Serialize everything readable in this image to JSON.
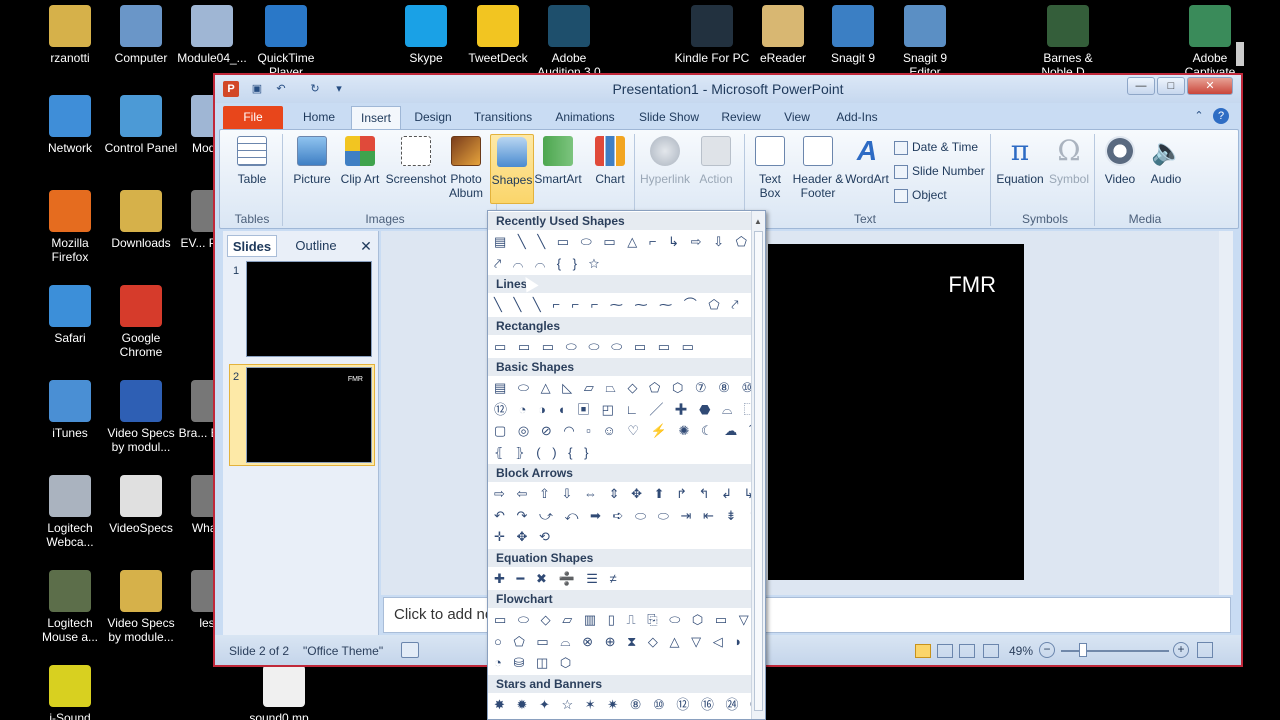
{
  "desktop": {
    "icons": [
      {
        "label": "rzanotti",
        "color": "#d6b14a"
      },
      {
        "label": "Computer",
        "color": "#6a96c8"
      },
      {
        "label": "Module04_...",
        "color": "#9fb6d4"
      },
      {
        "label": "QuickTime Player",
        "color": "#2a78c8"
      },
      {
        "label": "Skype",
        "color": "#1aa1e6"
      },
      {
        "label": "TweetDeck",
        "color": "#f2c521"
      },
      {
        "label": "Adobe Audition 3.0",
        "color": "#1e4f6c"
      },
      {
        "label": "Kindle For PC",
        "color": "#22313f"
      },
      {
        "label": "eReader",
        "color": "#d8b772"
      },
      {
        "label": "Snagit 9",
        "color": "#3b7fc4"
      },
      {
        "label": "Snagit 9 Editor",
        "color": "#5b8fc4"
      },
      {
        "label": "Barnes & Noble D...",
        "color": "#345e3a"
      },
      {
        "label": "Adobe Captivate",
        "color": "#3a8b5a"
      },
      {
        "label": "Network",
        "color": "#3f8ed8"
      },
      {
        "label": "Control Panel",
        "color": "#4c9ad6"
      },
      {
        "label": "Modu...",
        "color": "#9fb6d4"
      },
      {
        "label": "Mozilla Firefox",
        "color": "#e56c1f"
      },
      {
        "label": "Downloads",
        "color": "#d6b14a"
      },
      {
        "label": "EV... Prec...",
        "color": "#777"
      },
      {
        "label": "Safari",
        "color": "#3c8fd9"
      },
      {
        "label": "Google Chrome",
        "color": "#d63b2b"
      },
      {
        "label": "iTunes",
        "color": "#4a8fd4"
      },
      {
        "label": "Video Specs by modul...",
        "color": "#2e5fb4"
      },
      {
        "label": "Bra... Ener...",
        "color": "#777"
      },
      {
        "label": "Logitech Webca...",
        "color": "#aab3bf"
      },
      {
        "label": "VideoSpecs",
        "color": "#e0e0e0"
      },
      {
        "label": "What'...",
        "color": "#777"
      },
      {
        "label": "Logitech Mouse a...",
        "color": "#5c6e4a"
      },
      {
        "label": "Video Specs by module...",
        "color": "#d6b14a"
      },
      {
        "label": "les...",
        "color": "#777"
      },
      {
        "label": "i-Sound",
        "color": "#d8d020"
      },
      {
        "label": "sound0.mp...",
        "color": "#f0f0f0"
      }
    ]
  },
  "window": {
    "title": "Presentation1 - Microsoft PowerPoint",
    "app_icon": "P",
    "controls": {
      "minimize": "—",
      "maximize": "□",
      "close": "✕"
    },
    "accent": "#e8461b"
  },
  "tabs": [
    "File",
    "Home",
    "Insert",
    "Design",
    "Transitions",
    "Animations",
    "Slide Show",
    "Review",
    "View",
    "Add-Ins"
  ],
  "active_tab": "Insert",
  "ribbon": {
    "tables": {
      "table": "Table",
      "group": "Tables"
    },
    "images": {
      "picture": "Picture",
      "clipart": "Clip Art",
      "screenshot": "Screenshot",
      "photo_album": "Photo Album",
      "group": "Images"
    },
    "illustrations": {
      "shapes": "Shapes",
      "smartart": "SmartArt",
      "chart": "Chart"
    },
    "links": {
      "hyperlink": "Hyperlink",
      "action": "Action"
    },
    "text": {
      "textbox": "Text Box",
      "header_footer": "Header & Footer",
      "wordart": "WordArt",
      "date_time": "Date & Time",
      "slide_number": "Slide Number",
      "object": "Object",
      "group": "Text"
    },
    "symbols": {
      "equation": "Equation",
      "symbol": "Symbol",
      "group": "Symbols"
    },
    "media": {
      "video": "Video",
      "audio": "Audio",
      "group": "Media"
    }
  },
  "panel": {
    "tab_slides": "Slides",
    "tab_outline": "Outline",
    "close": "✕",
    "slides": [
      {
        "num": "1",
        "text": ""
      },
      {
        "num": "2",
        "text": "FMR"
      }
    ]
  },
  "slide": {
    "text": "FMR"
  },
  "notes_placeholder": "Click to add no",
  "status": {
    "slide": "Slide 2 of 2",
    "theme": "\"Office Theme\"",
    "zoom": "49%"
  },
  "shapes_menu": {
    "sections": [
      {
        "title": "Recently Used Shapes",
        "rows": [
          "▤ ╲ ╲ ▭ ⬭ ▭ △ ⌐ ↳ ⇨ ⇩ ⬠",
          "⤤ ⌒ ⌒ { } ☆"
        ]
      },
      {
        "title": "Lines",
        "rows": [
          "╲ ╲ ╲ ⌐ ⌐ ⌐ ⁓ ⁓ ⁓ ⌒ ⬠ ⤤"
        ]
      },
      {
        "title": "Rectangles",
        "rows": [
          "▭ ▭ ▭ ⬭ ⬭ ⬭ ▭ ▭ ▭"
        ]
      },
      {
        "title": "Basic Shapes",
        "rows": [
          "▤ ⬭ △ ◺ ▱ ⏢ ◇ ⬠ ⬡ ⑦ ⑧ ⑩",
          "⑫ ◔ ◑ ◖ ▣ ◰ ∟ ╱ ✚ ⬣ ⌓ ⬚",
          "▢ ◎ ⊘ ◠ ▫ ☺ ♡ ⚡ ✺ ☾ ☁ ⌒",
          "⦃ ⦄ ( ) { }"
        ]
      },
      {
        "title": "Block Arrows",
        "rows": [
          "⇨ ⇦ ⇧ ⇩ ⇔ ⇕ ✥ ⬆ ↱ ↰ ↲ ↳",
          "↶ ↷ ⤻ ⤺ ➡ ➪ ⬭ ⬭ ⇥ ⇤ ⇟ ⇞",
          "✛ ✥ ⟲"
        ]
      },
      {
        "title": "Equation Shapes",
        "rows": [
          "✚ ━ ✖ ➗ ☰ ≠"
        ]
      },
      {
        "title": "Flowchart",
        "rows": [
          "▭ ⬭ ◇ ▱ ▥ ▯ ⎍ ⎘ ⬭ ⬡ ▭ ▽",
          "○ ⬠ ▭ ⌓ ⊗ ⊕ ⧗ ◇ △ ▽ ◁ ◗",
          "◔ ⛁ ◫ ⬡"
        ]
      },
      {
        "title": "Stars and Banners",
        "rows": [
          "✸ ✹ ✦ ☆ ✶ ✷ ⑧ ⑩ ⑫ ⑯ ㉔ ㉜",
          "⌇ ⌇ ⌇ ⌇ ⌇ ⌇"
        ]
      }
    ]
  }
}
